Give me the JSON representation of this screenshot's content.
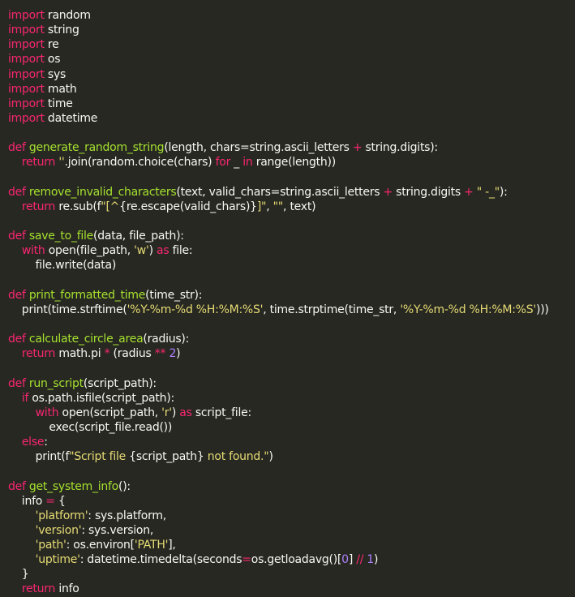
{
  "editor": {
    "language": "python",
    "colors": {
      "background": "#272822",
      "default": "#f8f8f2",
      "keyword": "#f92672",
      "function": "#a6e22e",
      "string": "#e6db74",
      "number": "#ae81ff"
    },
    "lines": [
      [
        {
          "t": "import",
          "k": "kw"
        },
        {
          "t": " random",
          "k": "id"
        }
      ],
      [
        {
          "t": "import",
          "k": "kw"
        },
        {
          "t": " string",
          "k": "id"
        }
      ],
      [
        {
          "t": "import",
          "k": "kw"
        },
        {
          "t": " re",
          "k": "id"
        }
      ],
      [
        {
          "t": "import",
          "k": "kw"
        },
        {
          "t": " os",
          "k": "id"
        }
      ],
      [
        {
          "t": "import",
          "k": "kw"
        },
        {
          "t": " sys",
          "k": "id"
        }
      ],
      [
        {
          "t": "import",
          "k": "kw"
        },
        {
          "t": " math",
          "k": "id"
        }
      ],
      [
        {
          "t": "import",
          "k": "kw"
        },
        {
          "t": " time",
          "k": "id"
        }
      ],
      [
        {
          "t": "import",
          "k": "kw"
        },
        {
          "t": " datetime",
          "k": "id"
        }
      ],
      [],
      [
        {
          "t": "def",
          "k": "kw"
        },
        {
          "t": " ",
          "k": "id"
        },
        {
          "t": "generate_random_string",
          "k": "fn"
        },
        {
          "t": "(length, chars=string.ascii_letters ",
          "k": "id"
        },
        {
          "t": "+",
          "k": "op"
        },
        {
          "t": " string.digits):",
          "k": "id"
        }
      ],
      [
        {
          "t": "    ",
          "k": "id"
        },
        {
          "t": "return",
          "k": "kw"
        },
        {
          "t": " ",
          "k": "id"
        },
        {
          "t": "''",
          "k": "str"
        },
        {
          "t": ".join(random.choice(chars) ",
          "k": "id"
        },
        {
          "t": "for",
          "k": "kw"
        },
        {
          "t": " _ ",
          "k": "id"
        },
        {
          "t": "in",
          "k": "kw"
        },
        {
          "t": " range(length))",
          "k": "id"
        }
      ],
      [],
      [
        {
          "t": "def",
          "k": "kw"
        },
        {
          "t": " ",
          "k": "id"
        },
        {
          "t": "remove_invalid_characters",
          "k": "fn"
        },
        {
          "t": "(text, valid_chars=string.ascii_letters ",
          "k": "id"
        },
        {
          "t": "+",
          "k": "op"
        },
        {
          "t": " string.digits ",
          "k": "id"
        },
        {
          "t": "+",
          "k": "op"
        },
        {
          "t": " ",
          "k": "id"
        },
        {
          "t": "\" -_\"",
          "k": "str"
        },
        {
          "t": "):",
          "k": "id"
        }
      ],
      [
        {
          "t": "    ",
          "k": "id"
        },
        {
          "t": "return",
          "k": "kw"
        },
        {
          "t": " re.sub(f",
          "k": "id"
        },
        {
          "t": "\"[^",
          "k": "str"
        },
        {
          "t": "{re.escape(valid_chars)}",
          "k": "id"
        },
        {
          "t": "]\"",
          "k": "str"
        },
        {
          "t": ", ",
          "k": "id"
        },
        {
          "t": "\"\"",
          "k": "str"
        },
        {
          "t": ", text)",
          "k": "id"
        }
      ],
      [],
      [
        {
          "t": "def",
          "k": "kw"
        },
        {
          "t": " ",
          "k": "id"
        },
        {
          "t": "save_to_file",
          "k": "fn"
        },
        {
          "t": "(data, file_path):",
          "k": "id"
        }
      ],
      [
        {
          "t": "    ",
          "k": "id"
        },
        {
          "t": "with",
          "k": "kw"
        },
        {
          "t": " open(file_path, ",
          "k": "id"
        },
        {
          "t": "'w'",
          "k": "str"
        },
        {
          "t": ") ",
          "k": "id"
        },
        {
          "t": "as",
          "k": "kw"
        },
        {
          "t": " file:",
          "k": "id"
        }
      ],
      [
        {
          "t": "        file.write(data)",
          "k": "id"
        }
      ],
      [],
      [
        {
          "t": "def",
          "k": "kw"
        },
        {
          "t": " ",
          "k": "id"
        },
        {
          "t": "print_formatted_time",
          "k": "fn"
        },
        {
          "t": "(time_str):",
          "k": "id"
        }
      ],
      [
        {
          "t": "    print(time.strftime(",
          "k": "id"
        },
        {
          "t": "'%Y-%m-%d %H:%M:%S'",
          "k": "str"
        },
        {
          "t": ", time.strptime(time_str, ",
          "k": "id"
        },
        {
          "t": "'%Y-%m-%d %H:%M:%S'",
          "k": "str"
        },
        {
          "t": ")))",
          "k": "id"
        }
      ],
      [],
      [
        {
          "t": "def",
          "k": "kw"
        },
        {
          "t": " ",
          "k": "id"
        },
        {
          "t": "calculate_circle_area",
          "k": "fn"
        },
        {
          "t": "(radius):",
          "k": "id"
        }
      ],
      [
        {
          "t": "    ",
          "k": "id"
        },
        {
          "t": "return",
          "k": "kw"
        },
        {
          "t": " math.pi ",
          "k": "id"
        },
        {
          "t": "*",
          "k": "op"
        },
        {
          "t": " (radius ",
          "k": "id"
        },
        {
          "t": "**",
          "k": "op"
        },
        {
          "t": " ",
          "k": "id"
        },
        {
          "t": "2",
          "k": "num"
        },
        {
          "t": ")",
          "k": "id"
        }
      ],
      [],
      [
        {
          "t": "def",
          "k": "kw"
        },
        {
          "t": " ",
          "k": "id"
        },
        {
          "t": "run_script",
          "k": "fn"
        },
        {
          "t": "(script_path):",
          "k": "id"
        }
      ],
      [
        {
          "t": "    ",
          "k": "id"
        },
        {
          "t": "if",
          "k": "kw"
        },
        {
          "t": " os.path.isfile(script_path):",
          "k": "id"
        }
      ],
      [
        {
          "t": "        ",
          "k": "id"
        },
        {
          "t": "with",
          "k": "kw"
        },
        {
          "t": " open(script_path, ",
          "k": "id"
        },
        {
          "t": "'r'",
          "k": "str"
        },
        {
          "t": ") ",
          "k": "id"
        },
        {
          "t": "as",
          "k": "kw"
        },
        {
          "t": " script_file:",
          "k": "id"
        }
      ],
      [
        {
          "t": "            exec(script_file.read())",
          "k": "id"
        }
      ],
      [
        {
          "t": "    ",
          "k": "id"
        },
        {
          "t": "else",
          "k": "kw"
        },
        {
          "t": ":",
          "k": "id"
        }
      ],
      [
        {
          "t": "        print(f",
          "k": "id"
        },
        {
          "t": "\"Script file ",
          "k": "str"
        },
        {
          "t": "{script_path}",
          "k": "id"
        },
        {
          "t": " not found.\"",
          "k": "str"
        },
        {
          "t": ")",
          "k": "id"
        }
      ],
      [],
      [
        {
          "t": "def",
          "k": "kw"
        },
        {
          "t": " ",
          "k": "id"
        },
        {
          "t": "get_system_info",
          "k": "fn"
        },
        {
          "t": "():",
          "k": "id"
        }
      ],
      [
        {
          "t": "    info ",
          "k": "id"
        },
        {
          "t": "=",
          "k": "op"
        },
        {
          "t": " {",
          "k": "id"
        }
      ],
      [
        {
          "t": "        ",
          "k": "id"
        },
        {
          "t": "'platform'",
          "k": "str"
        },
        {
          "t": ": sys.platform,",
          "k": "id"
        }
      ],
      [
        {
          "t": "        ",
          "k": "id"
        },
        {
          "t": "'version'",
          "k": "str"
        },
        {
          "t": ": sys.version,",
          "k": "id"
        }
      ],
      [
        {
          "t": "        ",
          "k": "id"
        },
        {
          "t": "'path'",
          "k": "str"
        },
        {
          "t": ": os.environ[",
          "k": "id"
        },
        {
          "t": "'PATH'",
          "k": "str"
        },
        {
          "t": "],",
          "k": "id"
        }
      ],
      [
        {
          "t": "        ",
          "k": "id"
        },
        {
          "t": "'uptime'",
          "k": "str"
        },
        {
          "t": ": datetime.timedelta(seconds",
          "k": "id"
        },
        {
          "t": "=",
          "k": "op"
        },
        {
          "t": "os.getloadavg()[",
          "k": "id"
        },
        {
          "t": "0",
          "k": "num"
        },
        {
          "t": "] ",
          "k": "id"
        },
        {
          "t": "//",
          "k": "op"
        },
        {
          "t": " ",
          "k": "id"
        },
        {
          "t": "1",
          "k": "num"
        },
        {
          "t": ")",
          "k": "id"
        }
      ],
      [
        {
          "t": "    }",
          "k": "id"
        }
      ],
      [
        {
          "t": "    ",
          "k": "id"
        },
        {
          "t": "return",
          "k": "kw"
        },
        {
          "t": " info",
          "k": "id"
        }
      ]
    ]
  }
}
